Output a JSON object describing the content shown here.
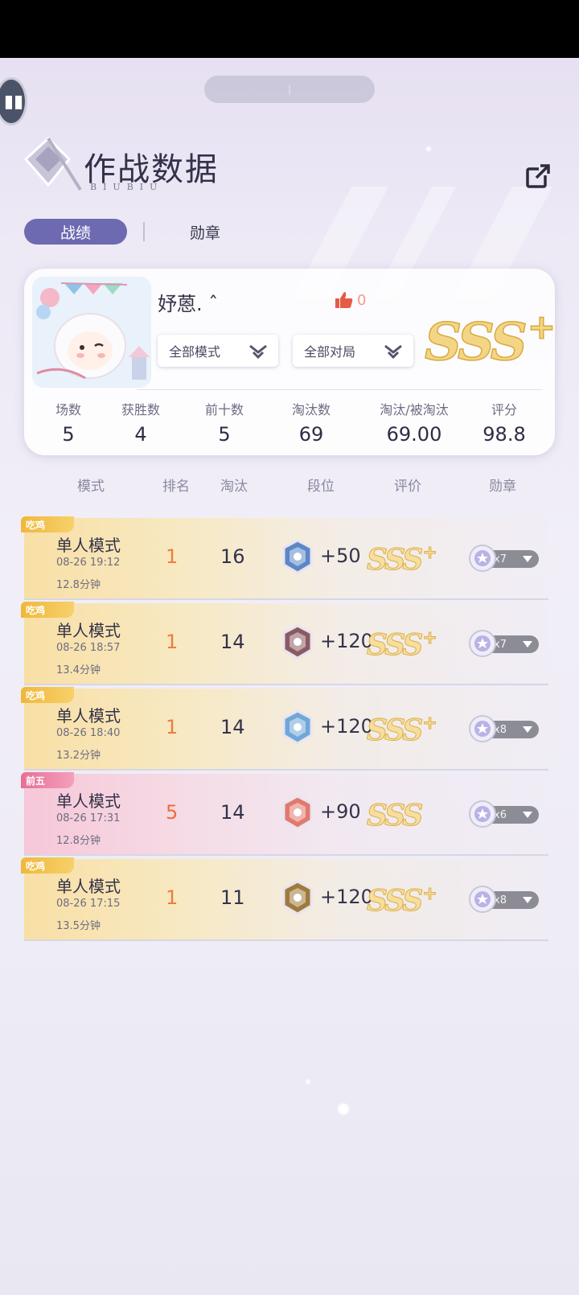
{
  "app": {
    "title": "作战数据",
    "subtitle": "BIUBIU"
  },
  "top_pill": {
    "left": "",
    "right": ""
  },
  "tabs": [
    {
      "label": "战绩",
      "active": true
    },
    {
      "label": "勋章",
      "active": false
    }
  ],
  "profile": {
    "username": "妤蒽. ˆ",
    "likes": "0",
    "filters": [
      {
        "label": "全部模式"
      },
      {
        "label": "全部对局"
      }
    ],
    "grade": "SSS",
    "grade_plus": "+",
    "stats": [
      {
        "label": "场数",
        "value": "5"
      },
      {
        "label": "获胜数",
        "value": "4"
      },
      {
        "label": "前十数",
        "value": "5"
      },
      {
        "label": "淘汰数",
        "value": "69"
      },
      {
        "label": "淘汰/被淘汰",
        "value": "69.00"
      },
      {
        "label": "评分",
        "value": "98.8"
      }
    ]
  },
  "table": {
    "headers": [
      "模式",
      "排名",
      "淘汰",
      "段位",
      "评价",
      "勋章"
    ],
    "rows": [
      {
        "ribbon": "吃鸡",
        "mode": "单人模式",
        "date": "08-26 19:12",
        "duration": "12.8分钟",
        "rank": "1",
        "eliminations": "16",
        "tier_delta": "+50",
        "grade": "SSS",
        "grade_plus": "+",
        "medals": "x7",
        "style": "win",
        "tier_color": "#5b87c7"
      },
      {
        "ribbon": "吃鸡",
        "mode": "单人模式",
        "date": "08-26 18:57",
        "duration": "13.4分钟",
        "rank": "1",
        "eliminations": "14",
        "tier_delta": "+120",
        "grade": "SSS",
        "grade_plus": "+",
        "medals": "x7",
        "style": "win",
        "tier_color": "#8a5a63"
      },
      {
        "ribbon": "吃鸡",
        "mode": "单人模式",
        "date": "08-26 18:40",
        "duration": "13.2分钟",
        "rank": "1",
        "eliminations": "14",
        "tier_delta": "+120",
        "grade": "SSS",
        "grade_plus": "+",
        "medals": "x8",
        "style": "win",
        "tier_color": "#6fa7d8"
      },
      {
        "ribbon": "前五",
        "mode": "单人模式",
        "date": "08-26 17:31",
        "duration": "12.8分钟",
        "rank": "5",
        "eliminations": "14",
        "tier_delta": "+90",
        "grade": "SSS",
        "grade_plus": "",
        "medals": "x6",
        "style": "pink",
        "tier_color": "#e2796e"
      },
      {
        "ribbon": "吃鸡",
        "mode": "单人模式",
        "date": "08-26 17:15",
        "duration": "13.5分钟",
        "rank": "1",
        "eliminations": "11",
        "tier_delta": "+120",
        "grade": "SSS",
        "grade_plus": "+",
        "medals": "x8",
        "style": "win",
        "tier_color": "#a07a3c"
      }
    ]
  },
  "colors": {
    "accent": "#6d6ab2",
    "gold": "#f3d685",
    "rank_orange": "#ef7c3e"
  },
  "icons": {
    "back": "pause-icon",
    "share": "external-share-icon",
    "like": "thumbs-up-icon",
    "dropdown": "chevron-down-icon"
  }
}
